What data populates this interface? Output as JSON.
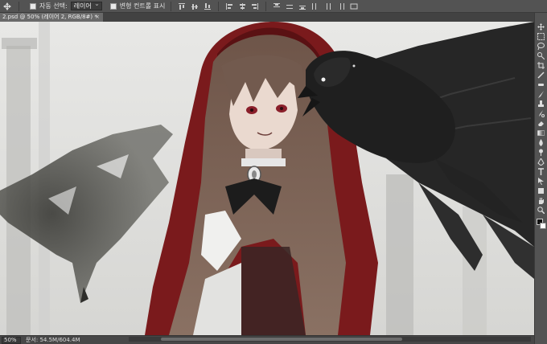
{
  "options_bar": {
    "tool_icon": "move-tool-icon",
    "auto_select_label": "자동 선택:",
    "auto_select_value": "레이어",
    "transform_controls_label": "변형 컨트롤 표시"
  },
  "document": {
    "tab_title": "2.psd @ 50% (레이어 2, RGB/8#) *",
    "close_glyph": "×"
  },
  "status": {
    "zoom": "50%",
    "doc_info": "문서: 54.5M/604.4M"
  },
  "tools": [
    "move-icon",
    "marquee-icon",
    "lasso-icon",
    "quick-select-icon",
    "crop-icon",
    "eyedropper-icon",
    "healing-brush-icon",
    "brush-icon",
    "clone-stamp-icon",
    "history-brush-icon",
    "eraser-icon",
    "gradient-icon",
    "blur-icon",
    "dodge-icon",
    "pen-icon",
    "type-icon",
    "path-select-icon",
    "shape-icon",
    "hand-icon",
    "zoom-icon"
  ],
  "colors": {
    "ui_dark": "#535353",
    "canvas_bg": "#e3e3e1",
    "cloak_red": "#7a1a1c",
    "hair_brown": "#7d6558",
    "crow_black": "#1f1f1f",
    "foreground_swatch": "#111111",
    "background_swatch": "#ffffff"
  }
}
